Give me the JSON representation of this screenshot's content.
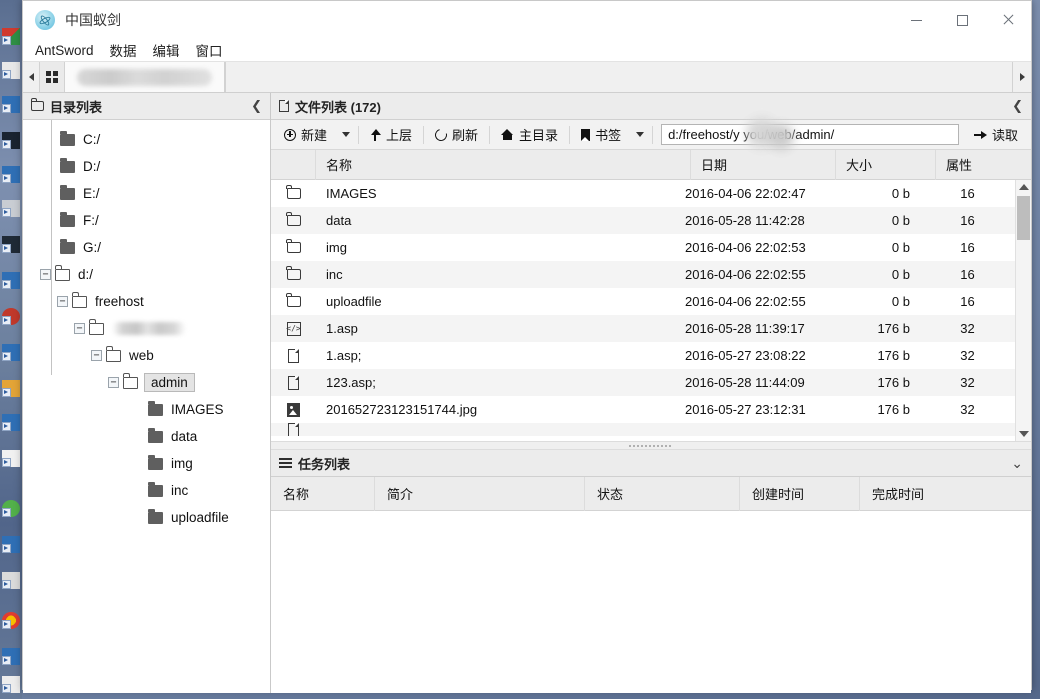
{
  "window": {
    "title": "中国蚁剑",
    "logo_icon": "antsword-logo-icon",
    "minimize_label": "—",
    "maximize_label": "□",
    "close_label": "✕"
  },
  "menubar": {
    "items": [
      {
        "label": "AntSword",
        "name": "menu-antsword"
      },
      {
        "label": "数据",
        "name": "menu-data"
      },
      {
        "label": "编辑",
        "name": "menu-edit"
      },
      {
        "label": "窗口",
        "name": "menu-window"
      }
    ]
  },
  "tabstrip": {
    "scroll_left_icon": "chevron-left-icon",
    "scroll_right_icon": "chevron-right-icon",
    "grid_tab_icon": "grid-icon",
    "active_tab_label": ""
  },
  "tree_panel": {
    "header": "目录列表",
    "header_icon": "folder-icon",
    "collapse_icon": "chevron-left-icon",
    "nodes": [
      {
        "label": "C:/",
        "depth": 1,
        "toggle": "",
        "icon": "folder-solid-icon",
        "selected": false
      },
      {
        "label": "D:/",
        "depth": 1,
        "toggle": "",
        "icon": "folder-solid-icon",
        "selected": false
      },
      {
        "label": "E:/",
        "depth": 1,
        "toggle": "",
        "icon": "folder-solid-icon",
        "selected": false
      },
      {
        "label": "F:/",
        "depth": 1,
        "toggle": "",
        "icon": "folder-solid-icon",
        "selected": false
      },
      {
        "label": "G:/",
        "depth": 1,
        "toggle": "",
        "icon": "folder-solid-icon",
        "selected": false
      },
      {
        "label": "d:/",
        "depth": 1,
        "toggle": "−",
        "icon": "folder-open-icon",
        "selected": false
      },
      {
        "label": "freehost",
        "depth": 2,
        "toggle": "−",
        "icon": "folder-open-icon",
        "selected": false
      },
      {
        "label": "",
        "depth": 3,
        "toggle": "−",
        "icon": "folder-open-icon",
        "selected": false,
        "redacted": true
      },
      {
        "label": "web",
        "depth": 4,
        "toggle": "−",
        "icon": "folder-open-icon",
        "selected": false
      },
      {
        "label": "admin",
        "depth": 5,
        "toggle": "−",
        "icon": "folder-open-icon",
        "selected": true
      },
      {
        "label": "IMAGES",
        "depth": 6,
        "toggle": "",
        "icon": "folder-solid-icon",
        "selected": false
      },
      {
        "label": "data",
        "depth": 6,
        "toggle": "",
        "icon": "folder-solid-icon",
        "selected": false
      },
      {
        "label": "img",
        "depth": 6,
        "toggle": "",
        "icon": "folder-solid-icon",
        "selected": false
      },
      {
        "label": "inc",
        "depth": 6,
        "toggle": "",
        "icon": "folder-solid-icon",
        "selected": false
      },
      {
        "label": "uploadfile",
        "depth": 6,
        "toggle": "",
        "icon": "folder-solid-icon",
        "selected": false
      }
    ]
  },
  "file_panel": {
    "header": "文件列表 (172)",
    "header_icon": "file-icon",
    "collapse_icon": "chevron-up-icon",
    "toolbar": {
      "new_label": "新建",
      "new_icon": "plus-circle-icon",
      "up_label": "上层",
      "up_icon": "arrow-up-icon",
      "refresh_label": "刷新",
      "refresh_icon": "refresh-icon",
      "home_label": "主目录",
      "home_icon": "home-icon",
      "bookmark_label": "书签",
      "bookmark_icon": "bookmark-icon",
      "read_label": "读取",
      "read_icon": "arrow-right-icon",
      "dropdown_icon": "caret-down-icon"
    },
    "path_value": "d:/freehost/y    you/web/admin/",
    "path_placeholder": "d:/",
    "columns": [
      "名称",
      "日期",
      "大小",
      "属性"
    ],
    "rows": [
      {
        "icon": "folder-icon",
        "name": "IMAGES",
        "date": "2016-04-06 22:02:47",
        "size": "0 b",
        "attr": "16"
      },
      {
        "icon": "folder-icon",
        "name": "data",
        "date": "2016-05-28 11:42:28",
        "size": "0 b",
        "attr": "16"
      },
      {
        "icon": "folder-icon",
        "name": "img",
        "date": "2016-04-06 22:02:53",
        "size": "0 b",
        "attr": "16"
      },
      {
        "icon": "folder-icon",
        "name": "inc",
        "date": "2016-04-06 22:02:55",
        "size": "0 b",
        "attr": "16"
      },
      {
        "icon": "folder-icon",
        "name": "uploadfile",
        "date": "2016-04-06 22:02:55",
        "size": "0 b",
        "attr": "16"
      },
      {
        "icon": "code-file-icon",
        "name": "1.asp",
        "date": "2016-05-28 11:39:17",
        "size": "176 b",
        "attr": "32"
      },
      {
        "icon": "file-icon",
        "name": "1.asp;",
        "date": "2016-05-27 23:08:22",
        "size": "176 b",
        "attr": "32"
      },
      {
        "icon": "file-icon",
        "name": "123.asp;",
        "date": "2016-05-28 11:44:09",
        "size": "176 b",
        "attr": "32"
      },
      {
        "icon": "image-file-icon",
        "name": "201652723123151744.jpg",
        "date": "2016-05-27 23:12:31",
        "size": "176 b",
        "attr": "32"
      },
      {
        "icon": "file-icon",
        "name": "",
        "date": "",
        "size": "",
        "attr": ""
      }
    ],
    "scroll_up_icon": "scroll-up-arrow-icon",
    "scroll_down_icon": "scroll-down-arrow-icon"
  },
  "task_panel": {
    "header": "任务列表",
    "header_icon": "list-icon",
    "collapse_icon": "chevron-down-icon",
    "columns": [
      "名称",
      "简介",
      "状态",
      "创建时间",
      "完成时间"
    ],
    "rows": []
  },
  "colors": {
    "window_bg": "#f0f0f0",
    "panel_header_bg": "#ececec",
    "row_alt_bg": "#f4f4f4",
    "border": "#d3d3d3",
    "desktop": "#6b7f9e"
  }
}
